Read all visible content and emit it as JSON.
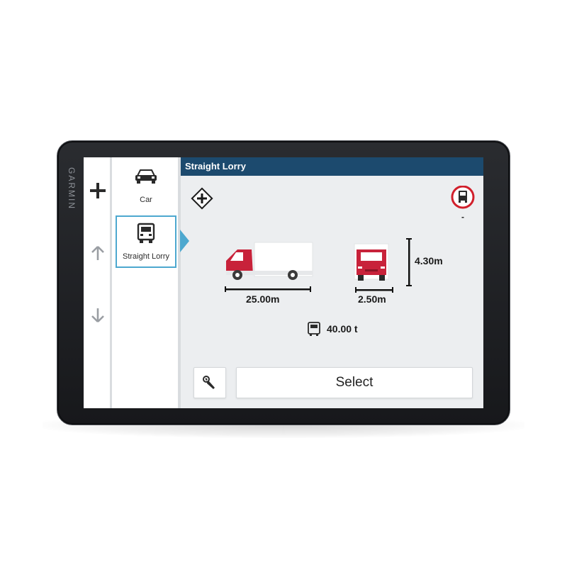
{
  "device": {
    "brand": "GARMIN"
  },
  "sidebar": {
    "add_icon": "plus-icon",
    "up_icon": "arrow-up-icon",
    "down_icon": "arrow-down-icon"
  },
  "vehicles": [
    {
      "label": "Car",
      "icon": "car-icon",
      "selected": false
    },
    {
      "label": "Straight Lorry",
      "icon": "lorry-icon",
      "selected": true
    }
  ],
  "main": {
    "title": "Straight Lorry",
    "length": "25.00m",
    "width": "2.50m",
    "height": "4.30m",
    "weight": "40.00 t",
    "restriction_label": "-",
    "select_label": "Select",
    "tools_icon": "wrench-icon",
    "add_point_icon": "diamond-plus-icon"
  },
  "colors": {
    "title_bar": "#1c4a6e",
    "accent": "#4da8cf",
    "truck_red": "#c8223a",
    "restriction_red": "#d11f2b"
  }
}
